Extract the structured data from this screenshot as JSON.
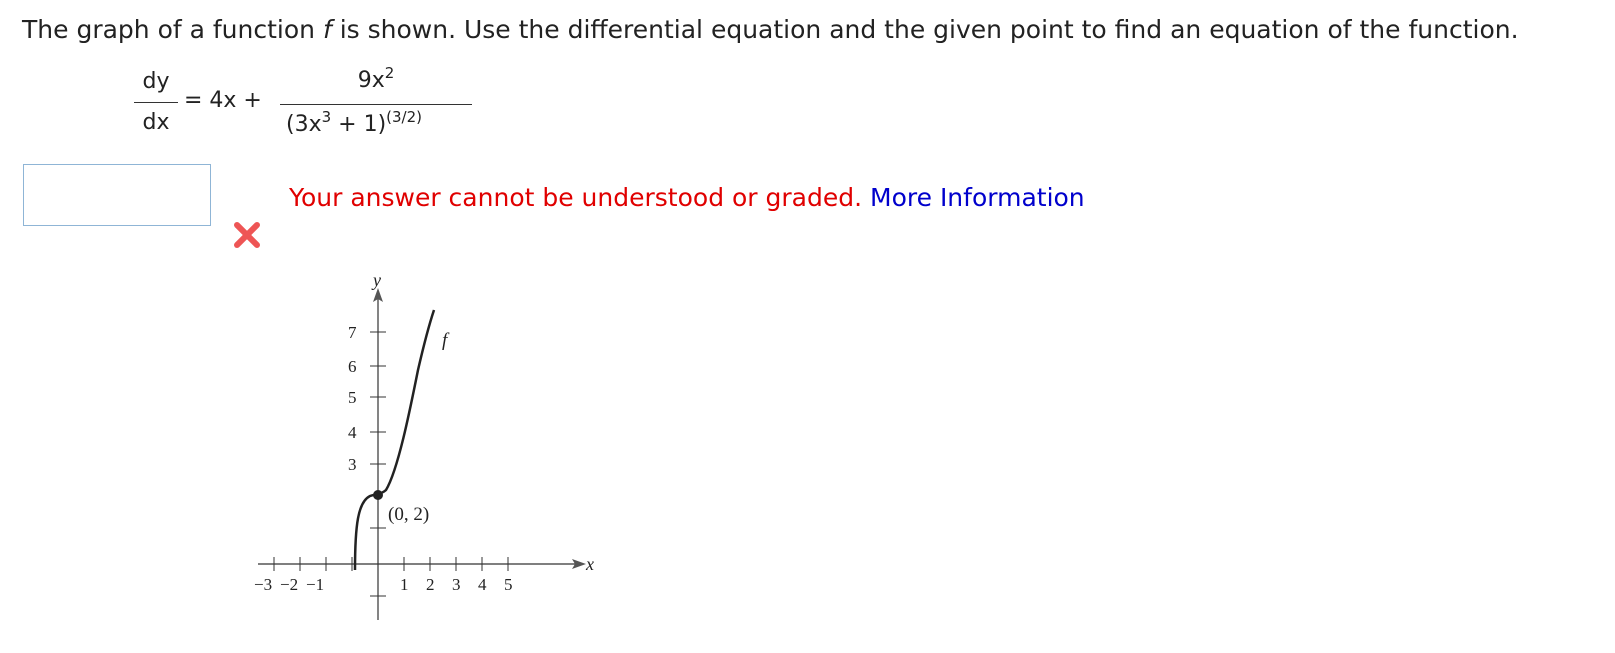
{
  "question": {
    "text_before": "The graph of a function ",
    "function_name": "f",
    "text_after": " is shown. Use the differential equation and the given point to find an equation of the function."
  },
  "equation": {
    "lhs_numerator": "dy",
    "lhs_denominator": "dx",
    "middle": "= 4x +",
    "rhs_numerator_base": "9x",
    "rhs_numerator_exp": "2",
    "rhs_den_part1": "(3x",
    "rhs_den_exp1": "3",
    "rhs_den_part2": " + 1)",
    "rhs_den_exp2": "(3/2)"
  },
  "answer": {
    "value": ""
  },
  "feedback": {
    "error_text": "Your answer cannot be understood or graded.",
    "link_text": "More Information",
    "error_color": "#e00000",
    "link_color": "#0000cc"
  },
  "status_icon": "red-x-icon",
  "graph": {
    "y_axis_label": "y",
    "x_axis_label": "x",
    "curve_label": "f",
    "point_label": "(0, 2)",
    "point": [
      0,
      2
    ],
    "y_tick_labels": [
      "3",
      "4",
      "5",
      "6",
      "7"
    ],
    "x_tick_labels": [
      "−3",
      "−2",
      "−1",
      "1",
      "2",
      "3",
      "4",
      "5"
    ]
  }
}
